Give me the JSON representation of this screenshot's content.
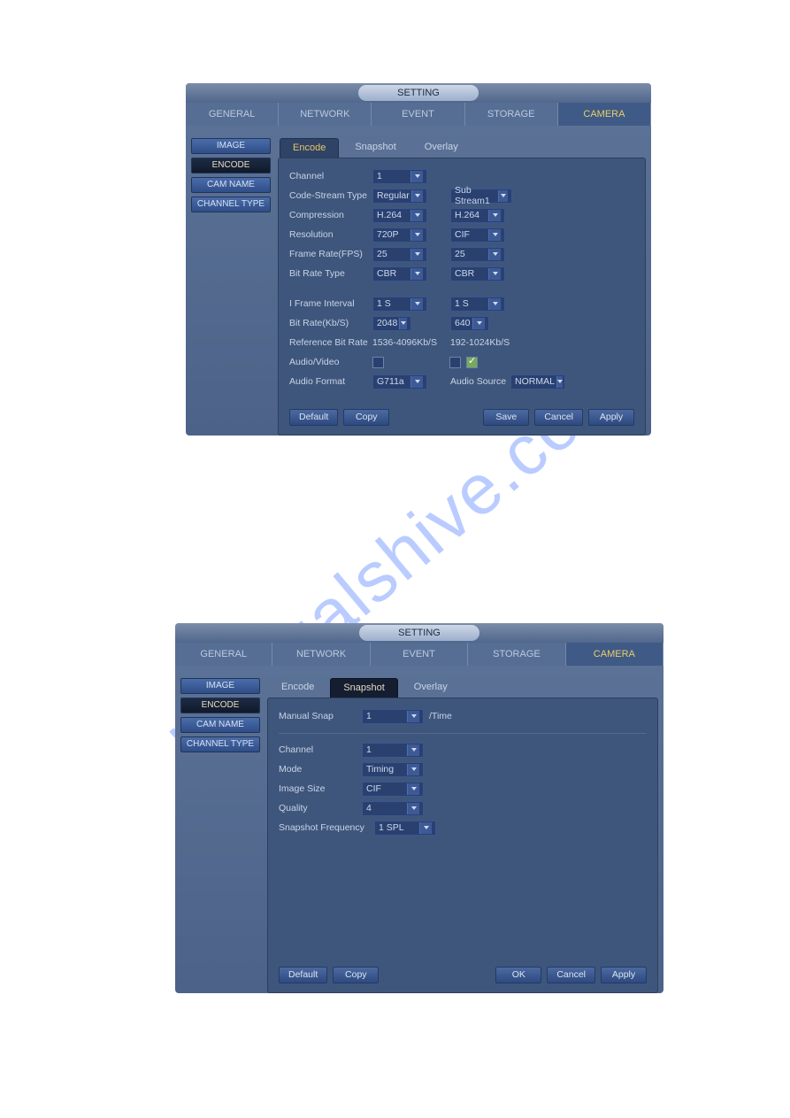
{
  "watermark": "manualshive.com",
  "window": {
    "title": "SETTING"
  },
  "topnav": [
    "GENERAL",
    "NETWORK",
    "EVENT",
    "STORAGE",
    "CAMERA"
  ],
  "sidebar": [
    "IMAGE",
    "ENCODE",
    "CAM NAME",
    "CHANNEL TYPE"
  ],
  "encode": {
    "subtabs": [
      "Encode",
      "Snapshot",
      "Overlay"
    ],
    "labels": {
      "channel": "Channel",
      "code_stream": "Code-Stream Type",
      "compression": "Compression",
      "resolution": "Resolution",
      "frame_rate": "Frame Rate(FPS)",
      "bitrate_type": "Bit Rate Type",
      "iframe": "I Frame Interval",
      "bitrate": "Bit Rate(Kb/S)",
      "ref_bitrate": "Reference Bit Rate",
      "audio_video": "Audio/Video",
      "audio_format": "Audio Format",
      "audio_source": "Audio Source"
    },
    "main": {
      "channel": "1",
      "code_stream": "Regular",
      "compression": "H.264",
      "resolution": "720P",
      "frame_rate": "25",
      "bitrate_type": "CBR",
      "iframe": "1 S",
      "bitrate": "2048",
      "ref_bitrate": "1536-4096Kb/S",
      "audio_format": "G711a"
    },
    "sub": {
      "stream": "Sub Stream1",
      "compression": "H.264",
      "resolution": "CIF",
      "frame_rate": "25",
      "bitrate_type": "CBR",
      "iframe": "1 S",
      "bitrate": "640",
      "ref_bitrate": "192-1024Kb/S",
      "audio_source": "NORMAL"
    },
    "buttons": {
      "default": "Default",
      "copy": "Copy",
      "save": "Save",
      "cancel": "Cancel",
      "apply": "Apply"
    }
  },
  "snapshot": {
    "subtabs": [
      "Encode",
      "Snapshot",
      "Overlay"
    ],
    "labels": {
      "manual_snap": "Manual Snap",
      "per_time": "/Time",
      "channel": "Channel",
      "mode": "Mode",
      "image_size": "Image Size",
      "quality": "Quality",
      "snap_freq": "Snapshot Frequency"
    },
    "values": {
      "manual_snap": "1",
      "channel": "1",
      "mode": "Timing",
      "image_size": "CIF",
      "quality": "4",
      "snap_freq": "1 SPL"
    },
    "buttons": {
      "default": "Default",
      "copy": "Copy",
      "ok": "OK",
      "cancel": "Cancel",
      "apply": "Apply"
    }
  }
}
